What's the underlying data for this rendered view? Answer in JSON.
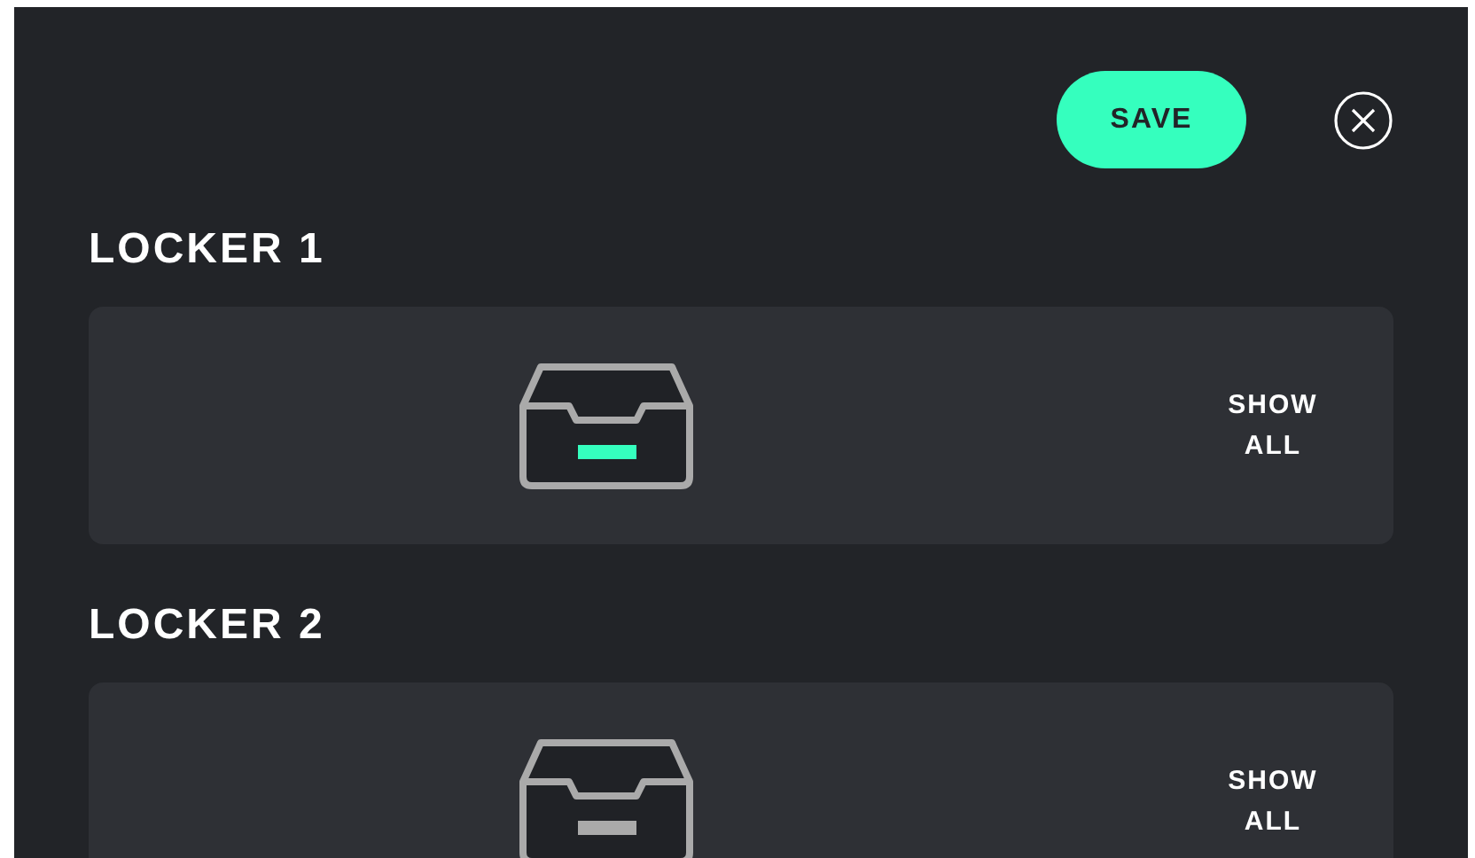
{
  "save_button": {
    "label": "SAVE"
  },
  "lockers": [
    {
      "title": "LOCKER 1",
      "active": true,
      "action": "SHOW ALL"
    },
    {
      "title": "LOCKER 2",
      "active": false,
      "action": "SHOW ALL"
    }
  ]
}
